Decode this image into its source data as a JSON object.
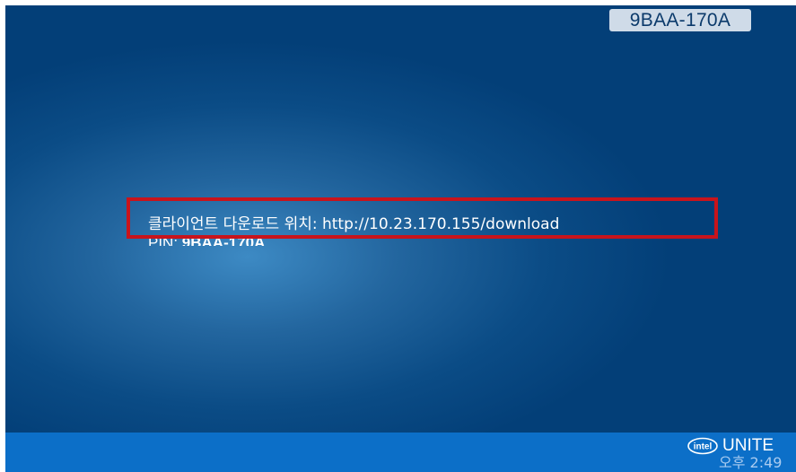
{
  "screen": {
    "pin_badge": "9BAA-170A",
    "download_line": "클라이언트 다운로드 위치: http://10.23.170.155/download",
    "pin_label": "PIN: ",
    "pin_value": "9BAA-170A"
  },
  "taskbar": {
    "logo_icon": "intel-logo-icon",
    "brand_text": "UNITE",
    "clock_text": "오후 2:49"
  },
  "colors": {
    "background_dark": "#033f78",
    "background_glow": "#3d8ac4",
    "highlight": "#c8141c",
    "taskbar": "#0c6fc8",
    "badge_bg": "#cfdbe8"
  }
}
